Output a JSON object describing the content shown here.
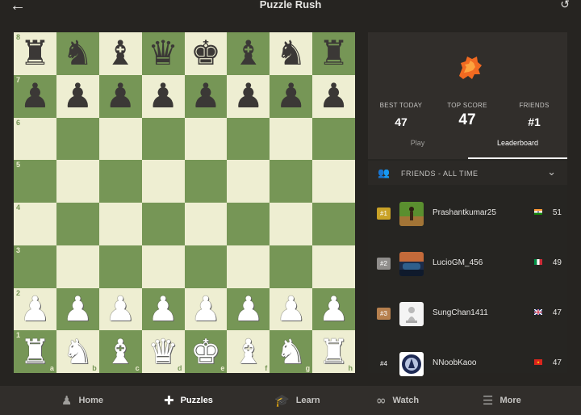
{
  "header": {
    "title": "Puzzle Rush",
    "back_icon": "arrow-left-icon",
    "history_icon": "history-icon"
  },
  "board": {
    "ranks": [
      "8",
      "7",
      "6",
      "5",
      "4",
      "3",
      "2",
      "1"
    ],
    "files": [
      "a",
      "b",
      "c",
      "d",
      "e",
      "f",
      "g",
      "h"
    ],
    "pieces": [
      "rnbqkbnr",
      "pppppppp",
      "........",
      "........",
      "........",
      "........",
      "PPPPPPPP",
      "RNBQKBNR"
    ],
    "colors": {
      "light": "#eeeed2",
      "dark": "#769656"
    }
  },
  "stats": [
    {
      "label": "BEST TODAY",
      "value": "47"
    },
    {
      "label": "TOP SCORE",
      "value": "47"
    },
    {
      "label": "FRIENDS",
      "value": "#1"
    }
  ],
  "tabs": {
    "play": "Play",
    "leaderboard": "Leaderboard"
  },
  "leaderboard": {
    "title": "FRIENDS - ALL TIME",
    "rows": [
      {
        "rank": "#1",
        "name": "Prashantkumar25",
        "flag": "india",
        "score": "51",
        "badge_color": "#c9a227"
      },
      {
        "rank": "#2",
        "name": "LucioGM_456",
        "flag": "italy",
        "score": "49",
        "badge_color": "#8f8d8b"
      },
      {
        "rank": "#3",
        "name": "SungChan1411",
        "flag": "uk",
        "score": "47",
        "badge_color": "#b6804e"
      },
      {
        "rank": "#4",
        "name": "NNoobKaoo",
        "flag": "vietnam",
        "score": "47",
        "badge_color": ""
      }
    ]
  },
  "nav": [
    {
      "label": "Home",
      "icon": "pawn-icon"
    },
    {
      "label": "Puzzles",
      "icon": "puzzle-icon",
      "active": true
    },
    {
      "label": "Learn",
      "icon": "graduation-cap-icon"
    },
    {
      "label": "Watch",
      "icon": "binoculars-icon"
    },
    {
      "label": "More",
      "icon": "menu-icon"
    }
  ]
}
